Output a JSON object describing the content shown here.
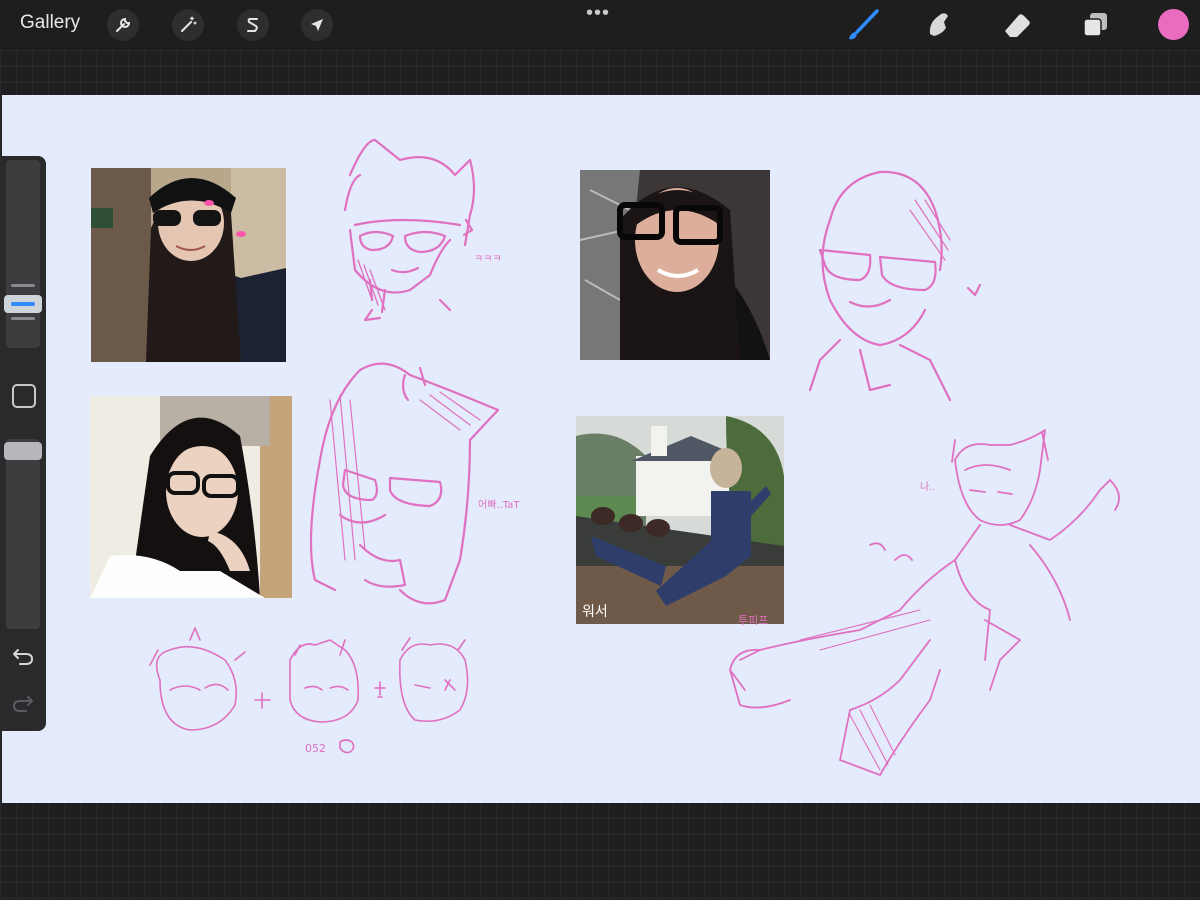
{
  "app": {
    "gallery_label": "Gallery",
    "more_menu": "•••",
    "current_color": "#e96cbf"
  },
  "toolbar_left": [
    {
      "name": "actions",
      "icon": "wrench-icon"
    },
    {
      "name": "adjustments",
      "icon": "magic-wand-icon"
    },
    {
      "name": "selection",
      "icon": "selection-s-icon"
    },
    {
      "name": "transform",
      "icon": "arrow-cursor-icon"
    }
  ],
  "toolbar_right": [
    {
      "name": "brush",
      "icon": "brush-icon",
      "active": true
    },
    {
      "name": "smudge",
      "icon": "smudge-icon"
    },
    {
      "name": "eraser",
      "icon": "eraser-icon"
    },
    {
      "name": "layers",
      "icon": "layers-icon"
    }
  ],
  "canvas": {
    "background": "#e3ebfc",
    "stroke_color": "#e070c0",
    "annotations": {
      "sketch1_note": "ㅋㅋㅋ",
      "sketch2_note": "어빠..TaT",
      "chibi_caption": "052",
      "photo4_caption": "워서",
      "full_body_note": "나..",
      "pose_caption": "투피프"
    },
    "photos": [
      {
        "name": "photo-beanie-glasses",
        "palette": [
          "#3a2e2a",
          "#1b1f2c",
          "#d8bfae"
        ]
      },
      {
        "name": "photo-black-frames-dark",
        "palette": [
          "#2c2525",
          "#111",
          "#d6a897"
        ]
      },
      {
        "name": "photo-hand-on-chin",
        "palette": [
          "#f2efe9",
          "#1a1414",
          "#e3c8b8"
        ]
      },
      {
        "name": "photo-outdoor-kick-pose",
        "palette": [
          "#5f7c52",
          "#2a3458",
          "#c9ccc6"
        ]
      }
    ]
  }
}
